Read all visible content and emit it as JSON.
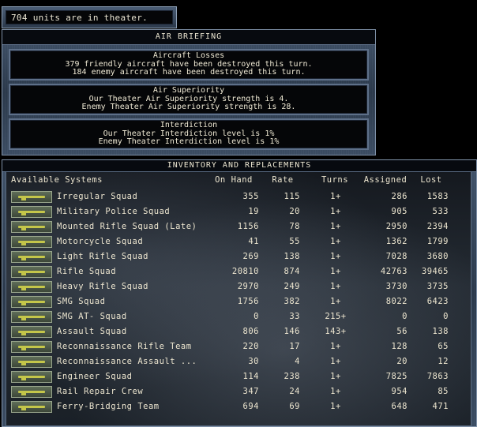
{
  "status_bar": {
    "text": "704 units are in theater."
  },
  "air_briefing": {
    "title": "AIR BRIEFING",
    "boxes": [
      {
        "heading": "Aircraft Losses",
        "line1": "379 friendly aircraft have been destroyed this turn.",
        "line2": "184 enemy aircraft have been destroyed this turn."
      },
      {
        "heading": "Air Superiority",
        "line1": "Our Theater Air Superiority strength is 4.",
        "line2": "Enemy Theater Air Superiority strength is 28."
      },
      {
        "heading": "Interdiction",
        "line1": "Our Theater Interdiction level is 1%",
        "line2": "Enemy Theater Interdiction level is 1%"
      }
    ]
  },
  "inventory": {
    "title": "INVENTORY AND REPLACEMENTS",
    "columns": {
      "name": "Available Systems",
      "on_hand": "On Hand",
      "rate": "Rate",
      "turns": "Turns",
      "assigned": "Assigned",
      "lost": "Lost"
    },
    "rows": [
      {
        "icon": "rifle-icon",
        "name": "Irregular Squad",
        "on_hand": "355",
        "rate": "115",
        "turns": "1+",
        "assigned": "286",
        "lost": "1583"
      },
      {
        "icon": "rifle-icon",
        "name": "Military Police Squad",
        "on_hand": "19",
        "rate": "20",
        "turns": "1+",
        "assigned": "905",
        "lost": "533"
      },
      {
        "icon": "horse-icon",
        "name": "Mounted Rifle Squad (Late)",
        "on_hand": "1156",
        "rate": "78",
        "turns": "1+",
        "assigned": "2950",
        "lost": "2394"
      },
      {
        "icon": "motorcycle-icon",
        "name": "Motorcycle Squad",
        "on_hand": "41",
        "rate": "55",
        "turns": "1+",
        "assigned": "1362",
        "lost": "1799"
      },
      {
        "icon": "rifle-icon",
        "name": "Light Rifle Squad",
        "on_hand": "269",
        "rate": "138",
        "turns": "1+",
        "assigned": "7028",
        "lost": "3680"
      },
      {
        "icon": "rifle-icon",
        "name": "Rifle Squad",
        "on_hand": "20810",
        "rate": "874",
        "turns": "1+",
        "assigned": "42763",
        "lost": "39465"
      },
      {
        "icon": "rifle-icon",
        "name": "Heavy Rifle Squad",
        "on_hand": "2970",
        "rate": "249",
        "turns": "1+",
        "assigned": "3730",
        "lost": "3735"
      },
      {
        "icon": "smg-icon",
        "name": "SMG Squad",
        "on_hand": "1756",
        "rate": "382",
        "turns": "1+",
        "assigned": "8022",
        "lost": "6423"
      },
      {
        "icon": "antitank-rifle-icon",
        "name": "SMG AT- Squad",
        "on_hand": "0",
        "rate": "33",
        "turns": "215+",
        "assigned": "0",
        "lost": "0"
      },
      {
        "icon": "smg-icon",
        "name": "Assault Squad",
        "on_hand": "806",
        "rate": "146",
        "turns": "143+",
        "assigned": "56",
        "lost": "138"
      },
      {
        "icon": "rifle-icon",
        "name": "Reconnaissance Rifle Team",
        "on_hand": "220",
        "rate": "17",
        "turns": "1+",
        "assigned": "128",
        "lost": "65"
      },
      {
        "icon": "smg-icon",
        "name": "Reconnaissance Assault ...",
        "on_hand": "30",
        "rate": "4",
        "turns": "1+",
        "assigned": "20",
        "lost": "12"
      },
      {
        "icon": "pickaxe-icon",
        "name": "Engineer Squad",
        "on_hand": "114",
        "rate": "238",
        "turns": "1+",
        "assigned": "7825",
        "lost": "7863"
      },
      {
        "icon": "pickaxe-icon",
        "name": "Rail Repair Crew",
        "on_hand": "347",
        "rate": "24",
        "turns": "1+",
        "assigned": "954",
        "lost": "85"
      },
      {
        "icon": "pickaxe-icon",
        "name": "Ferry-Bridging Team",
        "on_hand": "694",
        "rate": "69",
        "turns": "1+",
        "assigned": "648",
        "lost": "471"
      }
    ]
  }
}
